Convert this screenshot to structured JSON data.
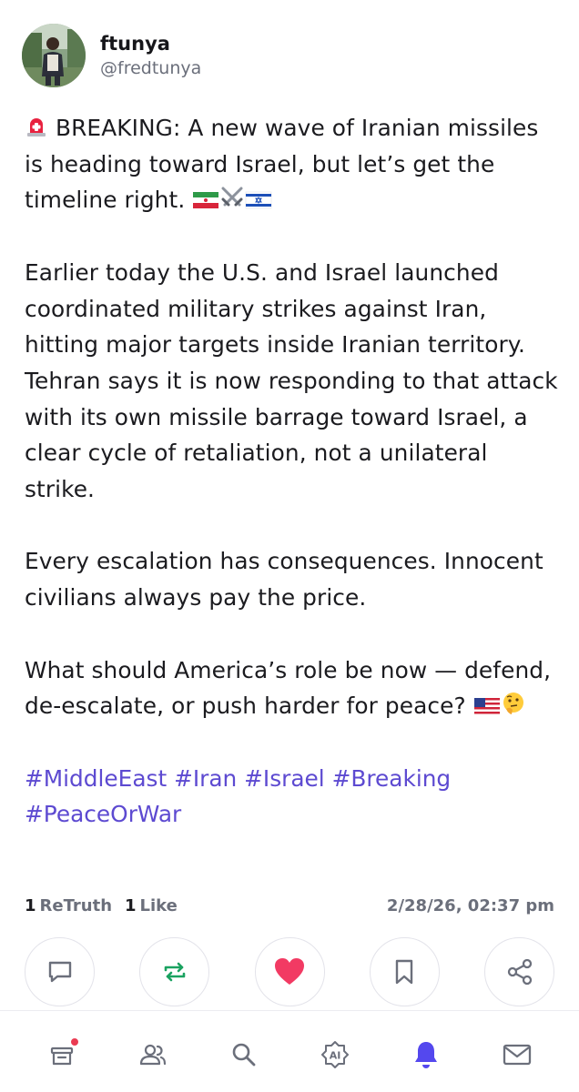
{
  "author": {
    "display_name": "ftunya",
    "handle": "@fredtunya"
  },
  "post": {
    "paragraphs": [
      {
        "prefix_icon": "siren-emoji",
        "text": " BREAKING: A new wave of Iranian missiles is heading toward Israel, but let’s get the timeline right. ",
        "suffix_icons": [
          "iran-flag-emoji",
          "crossed-swords-emoji",
          "israel-flag-emoji"
        ]
      },
      {
        "text": "Earlier today the U.S. and Israel launched coordinated military strikes against Iran, hitting major targets inside Iranian territory. Tehran says it is now responding to that attack with its own missile barrage toward Israel, a clear cycle of retaliation, not a unilateral strike."
      },
      {
        "text": "Every escalation has consequences. Innocent civilians always pay the price."
      },
      {
        "text": "What should America’s role be now — defend, de-escalate, or push harder for peace? ",
        "suffix_icons": [
          "us-flag-emoji",
          "thinking-face-emoji"
        ]
      }
    ],
    "hashtags": "#MiddleEast #Iran #Israel #Breaking #PeaceOrWar"
  },
  "stats": {
    "retruth_count": "1",
    "retruth_label": "ReTruth",
    "like_count": "1",
    "like_label": "Like",
    "timestamp": "2/28/26, 02:37 pm"
  },
  "actions": [
    "reply-icon",
    "retruth-icon",
    "like-heart-icon",
    "bookmark-icon",
    "share-icon"
  ],
  "colors": {
    "hashtag": "#5d4ad1",
    "retruth": "#1aa260",
    "heart": "#f23a63",
    "active_tab": "#5448ee",
    "badge": "#ea3b52",
    "icon_gray": "#6b6f7b"
  },
  "tabbar": {
    "items": [
      "home-icon",
      "groups-icon",
      "search-icon",
      "ai-icon",
      "notifications-bell-icon",
      "messages-icon"
    ],
    "active": "notifications-bell-icon"
  }
}
